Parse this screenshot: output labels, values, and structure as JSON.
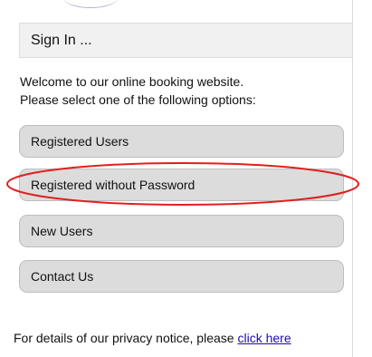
{
  "header": {
    "title": "Sign In ..."
  },
  "intro": {
    "line1": "Welcome to our online booking website.",
    "line2": "Please select one of the following options:"
  },
  "options": [
    {
      "label": "Registered Users"
    },
    {
      "label": "Registered without Password"
    },
    {
      "label": "New Users"
    },
    {
      "label": "Contact Us"
    }
  ],
  "highlight": {
    "color": "#e0201f"
  },
  "privacy": {
    "text": "For details of our privacy notice, please",
    "link_label": "click here",
    "link_color": "#1a0dab"
  }
}
